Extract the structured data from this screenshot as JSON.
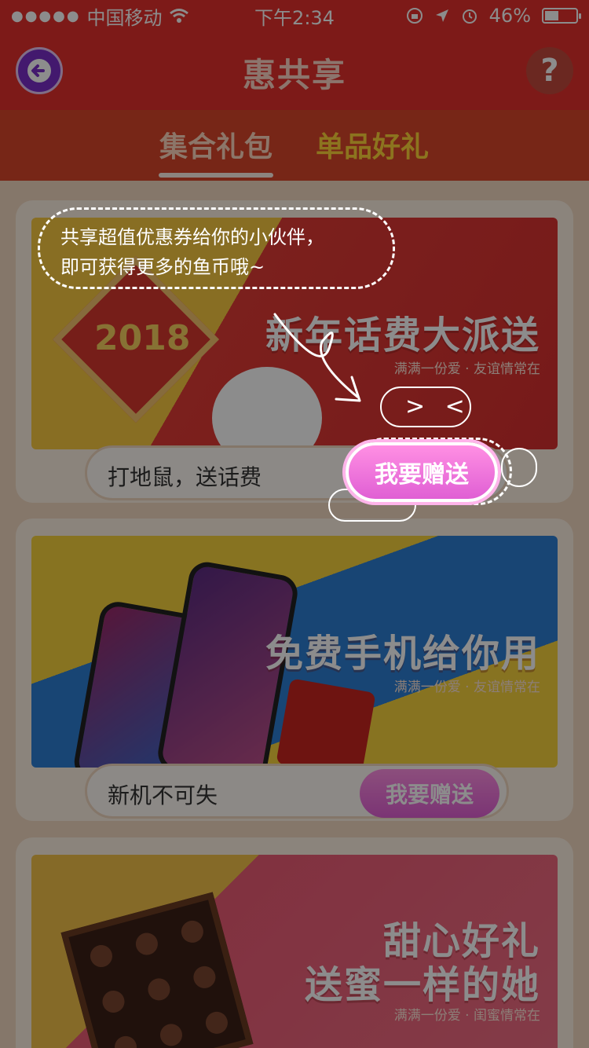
{
  "status_bar": {
    "carrier": "中国移动",
    "time": "下午2:34",
    "battery": "46%",
    "battery_level": 0.46
  },
  "nav": {
    "title": "惠共享",
    "help_symbol": "?"
  },
  "tabs": [
    {
      "label": "集合礼包",
      "active": true
    },
    {
      "label": "单品好礼",
      "active": false
    }
  ],
  "tip": {
    "line1": "共享超值优惠券给你的小伙伴，",
    "line2": "即可获得更多的鱼币哦~",
    "face": "> <"
  },
  "cards": [
    {
      "banner_badge": "2018",
      "banner_title": "新年话费大派送",
      "banner_subtitle": "满满一份爱 · 友谊情常在",
      "label": "打地鼠，送话费",
      "button": "我要赠送"
    },
    {
      "banner_title": "免费手机给你用",
      "banner_subtitle": "满满一份爱 · 友谊情常在",
      "label": "新机不可失",
      "button": "我要赠送"
    },
    {
      "banner_title_line1": "甜心好礼",
      "banner_title_line2": "送蜜一样的她",
      "banner_subtitle": "满满一份爱 · 闺蜜情常在"
    }
  ],
  "colors": {
    "brand_red": "#e3312c",
    "tab_active": "#ffd8c0",
    "tab_inactive": "#ffd33a",
    "button_pink": "#e05fd4"
  },
  "icons": [
    "back-arrow-icon",
    "help-icon",
    "wifi-icon",
    "lock-rotation-icon",
    "location-icon",
    "alarm-icon",
    "battery-icon"
  ]
}
